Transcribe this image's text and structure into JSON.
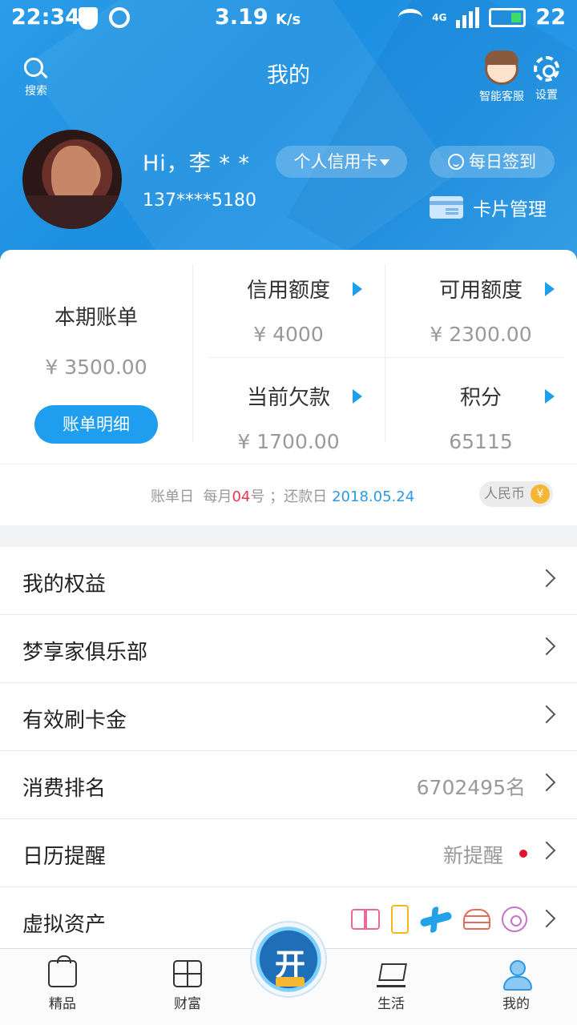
{
  "status_bar": {
    "time": "22:34",
    "speed": "3.19",
    "speed_unit": "K/s",
    "network": "4G",
    "battery": "22"
  },
  "header": {
    "search_label": "搜索",
    "title": "我的",
    "service_label": "智能客服",
    "settings_label": "设置"
  },
  "profile": {
    "greeting": "Hi，李 * *",
    "phone": "137****5180",
    "card_type": "个人信用卡",
    "checkin": "每日签到",
    "card_mgmt": "卡片管理"
  },
  "account": {
    "bill_title": "本期账单",
    "bill_amount": "¥ 3500.00",
    "bill_detail_btn": "账单明细",
    "credit_limit_label": "信用额度",
    "credit_limit_value": "¥ 4000",
    "available_label": "可用额度",
    "available_value": "¥ 2300.00",
    "debt_label": "当前欠款",
    "debt_value": "¥ 1700.00",
    "points_label": "积分",
    "points_value": "65115",
    "bill_day_prefix": "账单日  每月",
    "bill_day_num": "04",
    "bill_day_suffix": "号 ；还款日",
    "due_date": "2018.05.24",
    "currency": "人民币",
    "currency_symbol": "¥"
  },
  "menu": {
    "items": [
      {
        "label": "我的权益"
      },
      {
        "label": "梦享家俱乐部"
      },
      {
        "label": "有效刷卡金"
      },
      {
        "label": "消费排名",
        "extra": "6702495名"
      },
      {
        "label": "日历提醒",
        "extra": "新提醒"
      },
      {
        "label": "虚拟资产"
      }
    ]
  },
  "bottom_nav": {
    "items": [
      {
        "label": "精品",
        "icon": "bag-icon"
      },
      {
        "label": "财富",
        "icon": "calculator-icon"
      },
      {
        "label": "开",
        "icon": "open-center-icon"
      },
      {
        "label": "生活",
        "icon": "cart-icon"
      },
      {
        "label": "我的",
        "icon": "user-icon",
        "active": true
      }
    ]
  },
  "colors": {
    "header_blue": "#1d8fe0",
    "accent_blue": "#1f9ef0",
    "red_dot": "#e3132a",
    "bill_day_red": "#e6384b"
  }
}
